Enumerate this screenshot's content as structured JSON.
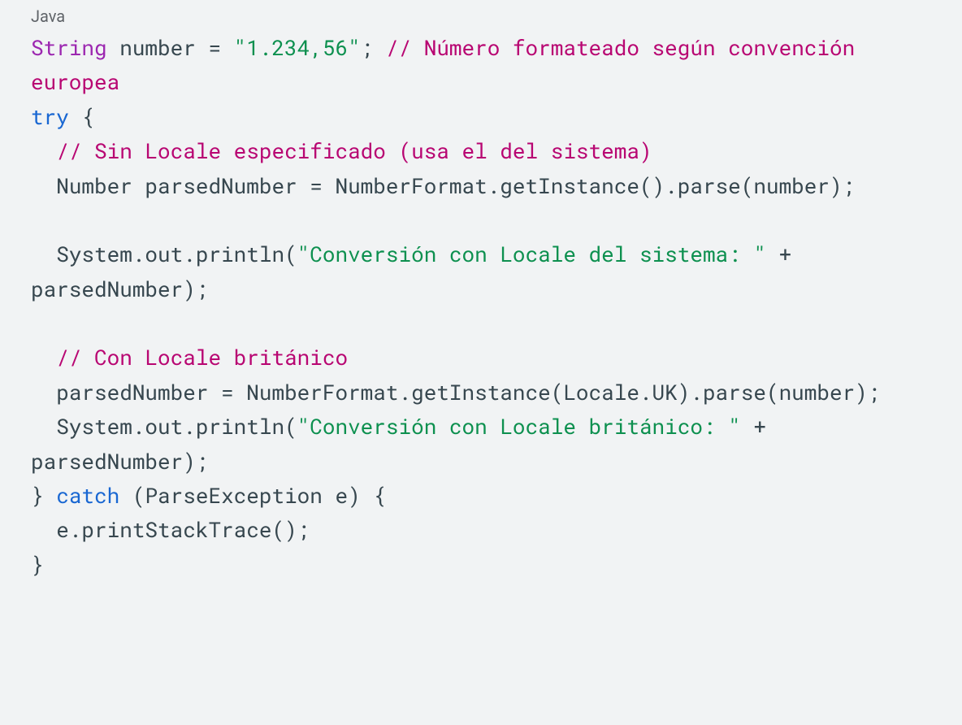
{
  "langLabel": "Java",
  "code": {
    "t1": "String",
    "t2": " number = ",
    "t3": "\"1.234,56\"",
    "t4": "; ",
    "t5": "// Número formateado según convención europea",
    "t6": "try",
    "t7": " {",
    "t8": "  ",
    "t9": "// Sin Locale especificado (usa el del sistema)",
    "t10": "  Number parsedNumber = NumberFormat.getInstance().parse(number);",
    "t11": "",
    "t12": "  System.out.println(",
    "t13": "\"Conversión con Locale del sistema: \"",
    "t14": " + parsedNumber);",
    "t15": "",
    "t16": "  ",
    "t17": "// Con Locale británico",
    "t18": "  parsedNumber = NumberFormat.getInstance(Locale.UK).parse(number);",
    "t19": "  System.out.println(",
    "t20": "\"Conversión con Locale británico: \"",
    "t21": " + parsedNumber);",
    "t22": "} ",
    "t23": "catch",
    "t24": " (ParseException e) {",
    "t25": "  e.printStackTrace();",
    "t26": "}"
  }
}
